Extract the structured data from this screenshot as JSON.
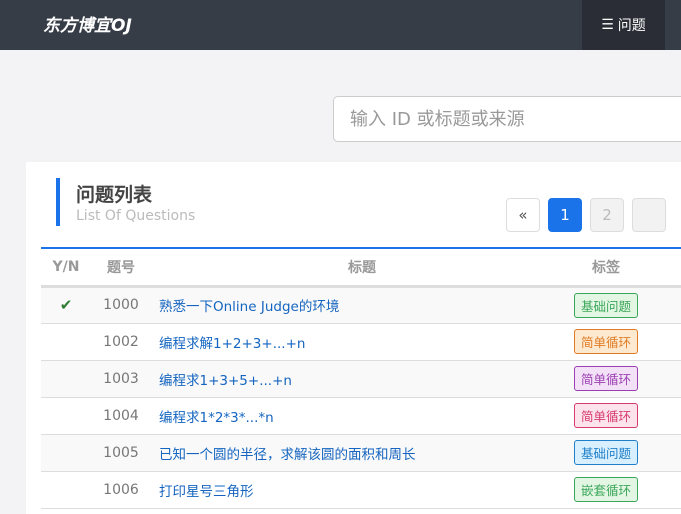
{
  "nav": {
    "brand": "东方博宜OJ",
    "items": [
      {
        "icon": "list-icon",
        "label": "问题"
      }
    ]
  },
  "search": {
    "placeholder": "输入 ID 或标题或来源",
    "value": ""
  },
  "section": {
    "title": "问题列表",
    "subtitle": "List Of Questions"
  },
  "pagination": {
    "prev": "«",
    "pages": [
      "1",
      "2"
    ],
    "current": "1"
  },
  "table": {
    "headers": [
      "Y/N",
      "题号",
      "标题",
      "标签"
    ],
    "rows": [
      {
        "solved": "✔",
        "id": "1000",
        "title": "熟悉一下Online Judge的环境",
        "tag": "基础问题",
        "tag_color": "#3aa65a",
        "tag_bg": "#e3f6e3"
      },
      {
        "solved": "",
        "id": "1002",
        "title": "编程求解1+2+3+...+n",
        "tag": "简单循环",
        "tag_color": "#e07b24",
        "tag_bg": "#fde9cf"
      },
      {
        "solved": "",
        "id": "1003",
        "title": "编程求1+3+5+...+n",
        "tag": "简单循环",
        "tag_color": "#9b3fb0",
        "tag_bg": "#f3e1f8"
      },
      {
        "solved": "",
        "id": "1004",
        "title": "编程求1*2*3*...*n",
        "tag": "简单循环",
        "tag_color": "#d63a6e",
        "tag_bg": "#fde3ec"
      },
      {
        "solved": "",
        "id": "1005",
        "title": "已知一个圆的半径，求解该圆的面积和周长",
        "tag": "基础问题",
        "tag_color": "#1f7fc8",
        "tag_bg": "#d7efff"
      },
      {
        "solved": "",
        "id": "1006",
        "title": "打印星号三角形",
        "tag": "嵌套循环",
        "tag_color": "#3aa65a",
        "tag_bg": "#e3f6e3"
      }
    ]
  }
}
